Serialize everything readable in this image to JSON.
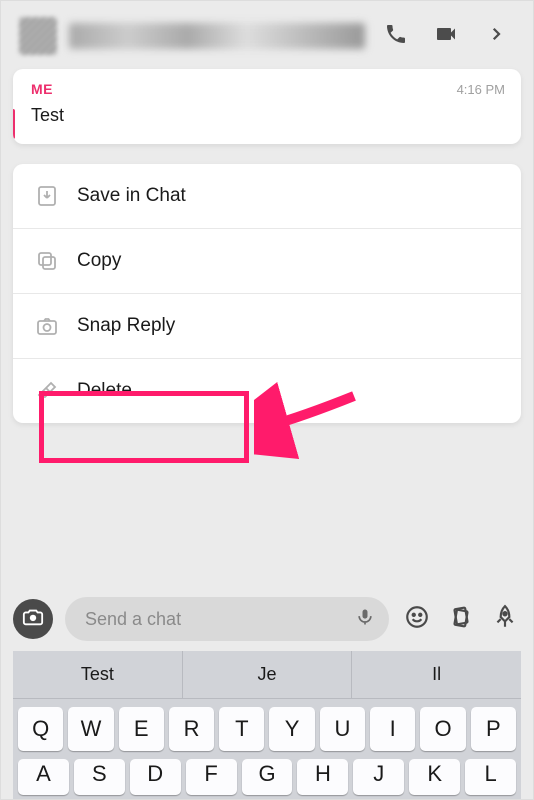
{
  "header": {
    "contact_name_obscured": true
  },
  "message": {
    "sender": "ME",
    "timestamp": "4:16 PM",
    "body": "Test"
  },
  "menu": {
    "save": "Save in Chat",
    "copy": "Copy",
    "snap_reply": "Snap Reply",
    "delete": "Delete"
  },
  "composer": {
    "placeholder": "Send a chat"
  },
  "keyboard": {
    "suggestions": [
      "Test",
      "Je",
      "Il"
    ],
    "row1": [
      "Q",
      "W",
      "E",
      "R",
      "T",
      "Y",
      "U",
      "I",
      "O",
      "P"
    ],
    "row2": [
      "A",
      "S",
      "D",
      "F",
      "G",
      "H",
      "J",
      "K",
      "L"
    ]
  },
  "colors": {
    "accent": "#ed2f6d",
    "highlight": "#ff1b6b"
  }
}
